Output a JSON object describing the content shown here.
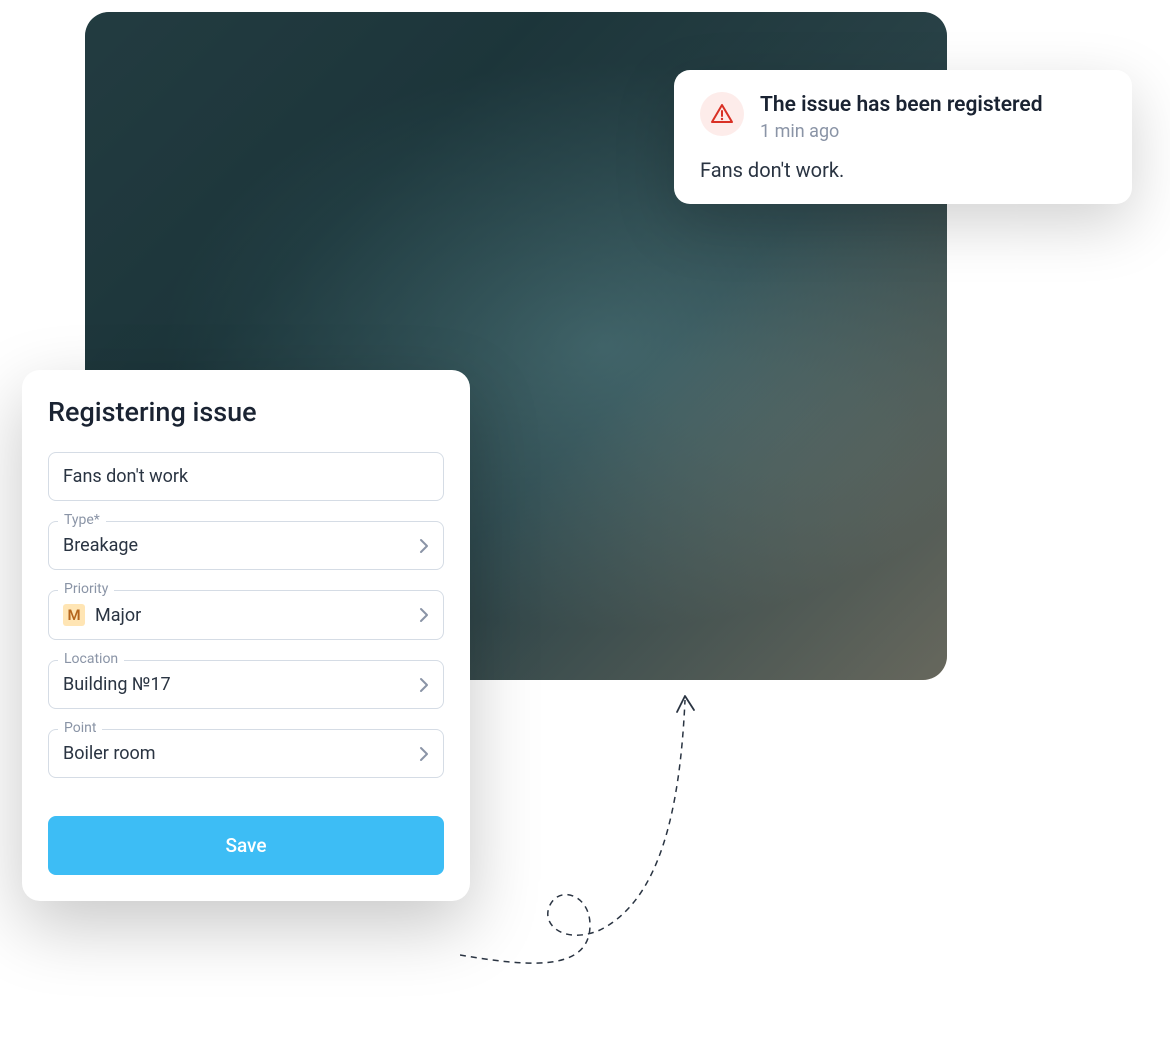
{
  "notification": {
    "title": "The issue has been registered",
    "time": "1 min ago",
    "body": "Fans don't work."
  },
  "form": {
    "title": "Registering issue",
    "description_value": "Fans don't work",
    "fields": {
      "type": {
        "label": "Type*",
        "value": "Breakage"
      },
      "priority": {
        "label": "Priority",
        "value": "Major",
        "badge": "M"
      },
      "location": {
        "label": "Location",
        "value": "Building №17"
      },
      "point": {
        "label": "Point",
        "value": "Boiler room"
      }
    },
    "save_label": "Save"
  },
  "colors": {
    "accent": "#3dbdf5",
    "alert": "#d93025",
    "alert_bg": "#fdecea",
    "priority_bg": "#ffe5b4",
    "priority_fg": "#b5651d"
  }
}
